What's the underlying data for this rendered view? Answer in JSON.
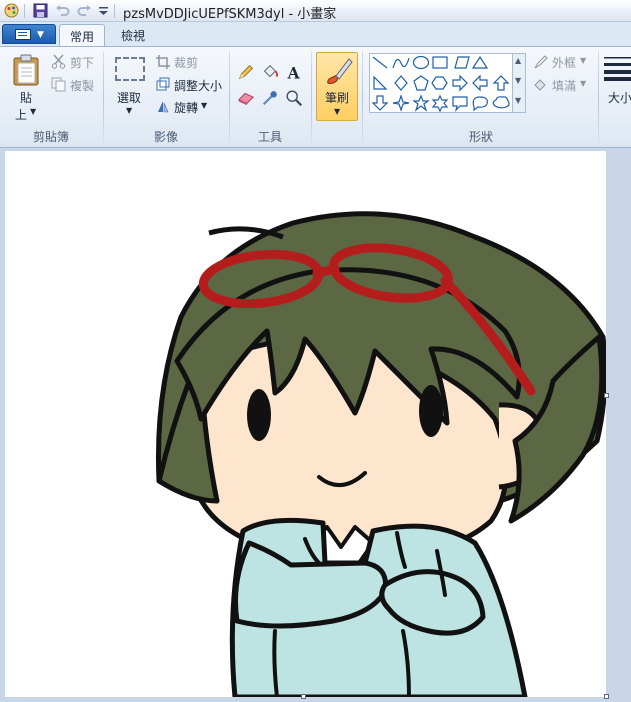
{
  "window": {
    "title": "pzsMvDDJicUEPfSKM3dyl - 小畫家"
  },
  "tabs": [
    {
      "label": "常用",
      "active": true
    },
    {
      "label": "檢視",
      "active": false
    }
  ],
  "clipboard": {
    "paste_label_1": "貼",
    "paste_label_2": "上",
    "cut_label": "剪下",
    "copy_label": "複製",
    "group_label": "剪貼簿"
  },
  "image": {
    "select_label": "選取",
    "crop_label": "裁剪",
    "resize_label": "調整大小",
    "rotate_label": "旋轉",
    "group_label": "影像"
  },
  "tools": {
    "group_label": "工具",
    "text_tool_glyph": "A"
  },
  "brushes": {
    "label": "筆刷"
  },
  "shapes": {
    "group_label": "形狀",
    "outline_label": "外框",
    "fill_label": "填滿"
  },
  "size": {
    "label": "大小"
  },
  "colors": {
    "ribbon_bg": "#e6edf6",
    "brush_highlight": "#ffcf62",
    "hair": "#5c6744",
    "glasses": "#b51d1d",
    "skin": "#fde6cd",
    "jacket": "#bde3e3"
  }
}
